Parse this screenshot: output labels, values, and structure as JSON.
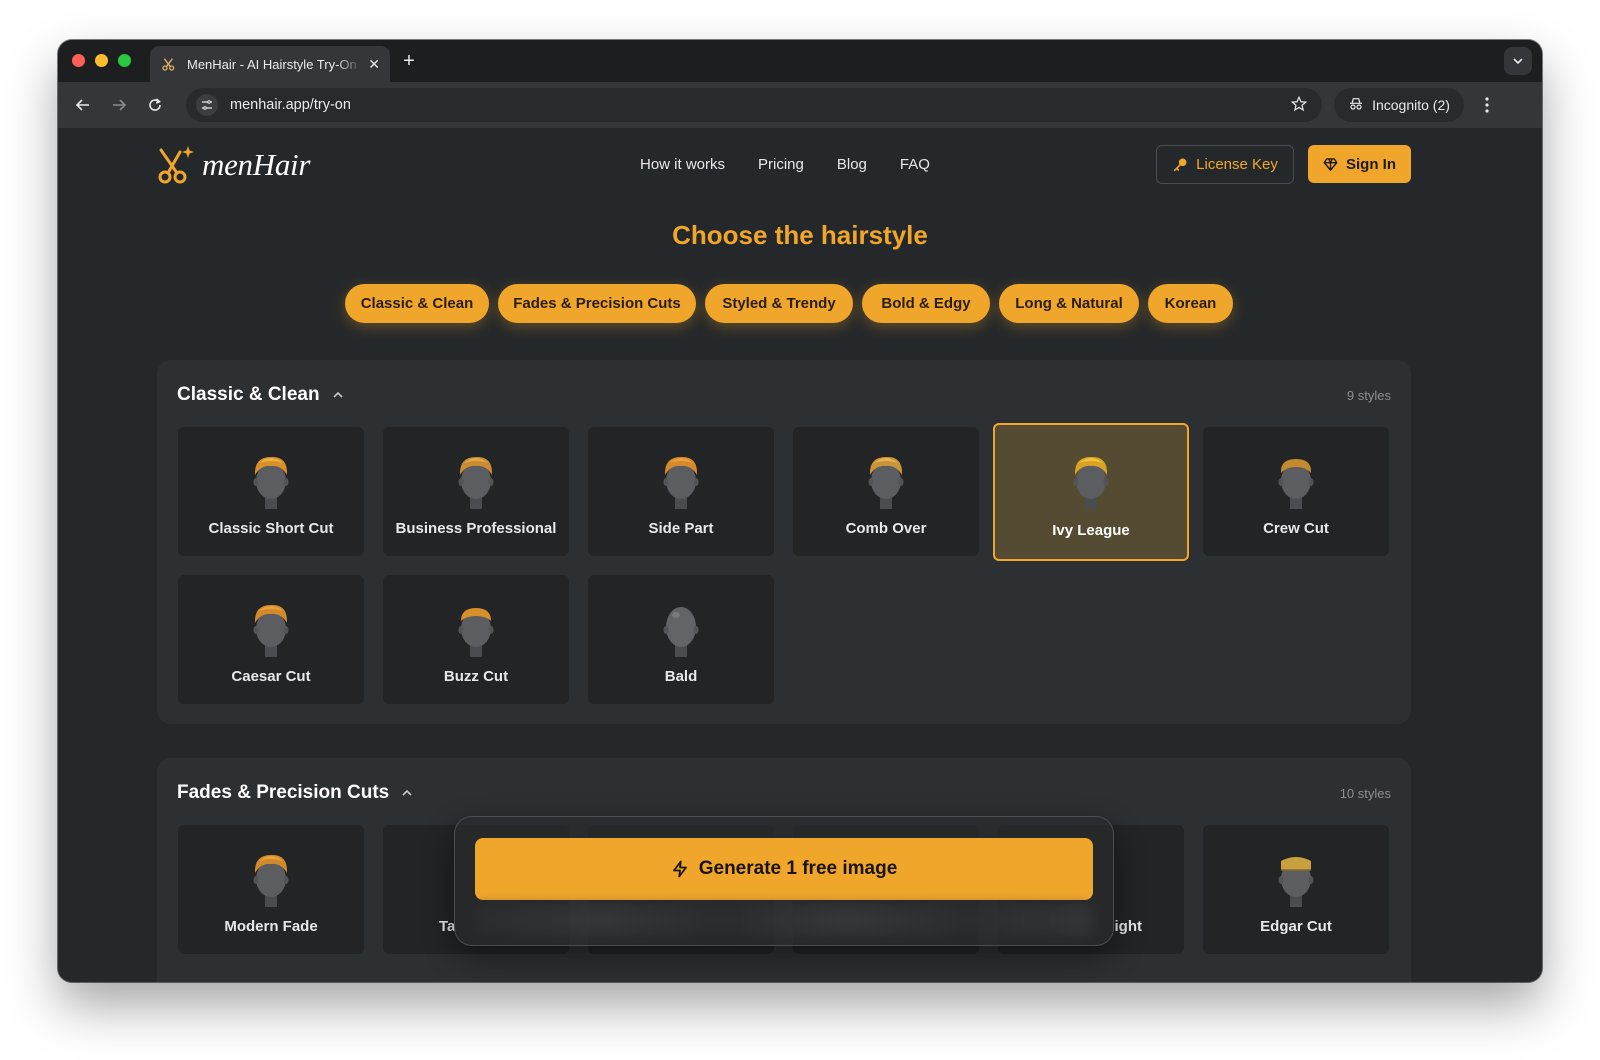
{
  "browser": {
    "tab_title": "MenHair - AI Hairstyle Try-On",
    "url": "menhair.app/try-on",
    "incognito_label": "Incognito (2)"
  },
  "site": {
    "logo_text": "menHair",
    "nav": [
      "How it works",
      "Pricing",
      "Blog",
      "FAQ"
    ],
    "license_label": "License Key",
    "signin_label": "Sign In",
    "accent_color": "#f0a62b"
  },
  "main": {
    "title": "Choose the hairstyle",
    "chips": [
      "Classic & Clean",
      "Fades & Precision Cuts",
      "Styled & Trendy",
      "Bold & Edgy",
      "Long & Natural",
      "Korean"
    ],
    "sections": [
      {
        "title": "Classic & Clean",
        "count": "9 styles",
        "styles": [
          "Classic Short Cut",
          "Business Professional",
          "Side Part",
          "Comb Over",
          "Ivy League",
          "Crew Cut",
          "Caesar Cut",
          "Buzz Cut",
          "Bald"
        ],
        "selected": "Ivy League"
      },
      {
        "title": "Fades & Precision Cuts",
        "count": "10 styles",
        "styles": [
          "Modern Fade",
          "Ta",
          "ight",
          "Edgar Cut"
        ]
      }
    ]
  },
  "generate": {
    "label": "Generate 1 free image"
  }
}
